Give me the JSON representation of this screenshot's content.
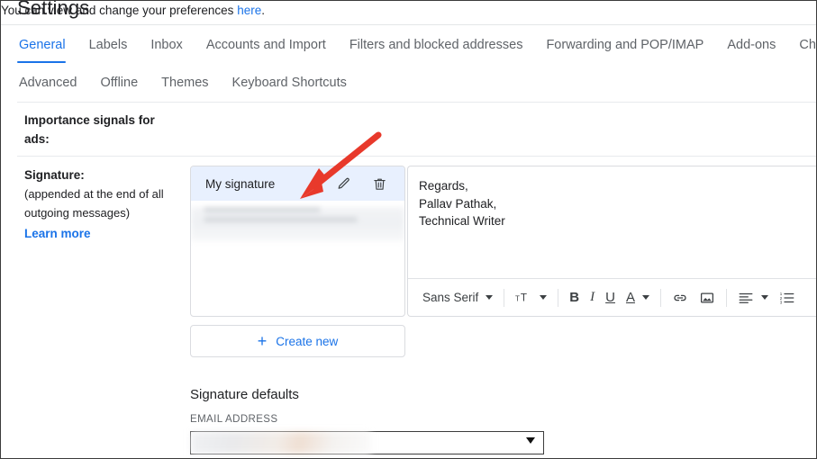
{
  "header": {
    "title": "Settings"
  },
  "tabs_row1": [
    {
      "label": "General",
      "active": true
    },
    {
      "label": "Labels",
      "active": false
    },
    {
      "label": "Inbox",
      "active": false
    },
    {
      "label": "Accounts and Import",
      "active": false
    },
    {
      "label": "Filters and blocked addresses",
      "active": false
    },
    {
      "label": "Forwarding and POP/IMAP",
      "active": false
    },
    {
      "label": "Add-ons",
      "active": false
    },
    {
      "label": "Chat and M",
      "active": false
    }
  ],
  "tabs_row2": [
    {
      "label": "Advanced"
    },
    {
      "label": "Offline"
    },
    {
      "label": "Themes"
    },
    {
      "label": "Keyboard Shortcuts"
    }
  ],
  "importance": {
    "label": "Importance signals for ads:",
    "text_before": "You can view and change your preferences ",
    "link": "here",
    "text_after": "."
  },
  "signature": {
    "label": "Signature:",
    "sublabel_line1": "(appended at the end of all",
    "sublabel_line2": "outgoing messages)",
    "learn_more": "Learn more",
    "items": [
      {
        "name": "My signature",
        "selected": true
      },
      {
        "name": "",
        "selected": false,
        "blurred": true
      }
    ],
    "edit_icon": "pencil-icon",
    "delete_icon": "trash-icon",
    "create_new": "Create new",
    "create_new_icon": "plus-icon",
    "editor": {
      "lines": [
        "Regards,",
        "Pallav Pathak,",
        "Technical Writer"
      ],
      "toolbar": {
        "font_family": "Sans Serif",
        "size_label": "тT",
        "bold": "B",
        "italic": "I",
        "underline": "U",
        "text_color": "A",
        "link_icon": "link-icon",
        "image_icon": "image-icon",
        "align_icon": "align-left-icon",
        "list_icon": "numbered-list-icon"
      }
    }
  },
  "signature_defaults": {
    "title": "Signature defaults",
    "email_address_label": "EMAIL ADDRESS",
    "email_select_value": ""
  },
  "annotation": {
    "arrow_color": "#e8392b",
    "arrow_from": "418,150",
    "arrow_to": "335,217"
  },
  "colors": {
    "accent": "#1a73e8",
    "selected_row": "#e8f0fe",
    "border": "#dadce0",
    "text": "#202124",
    "muted": "#5f6368"
  }
}
